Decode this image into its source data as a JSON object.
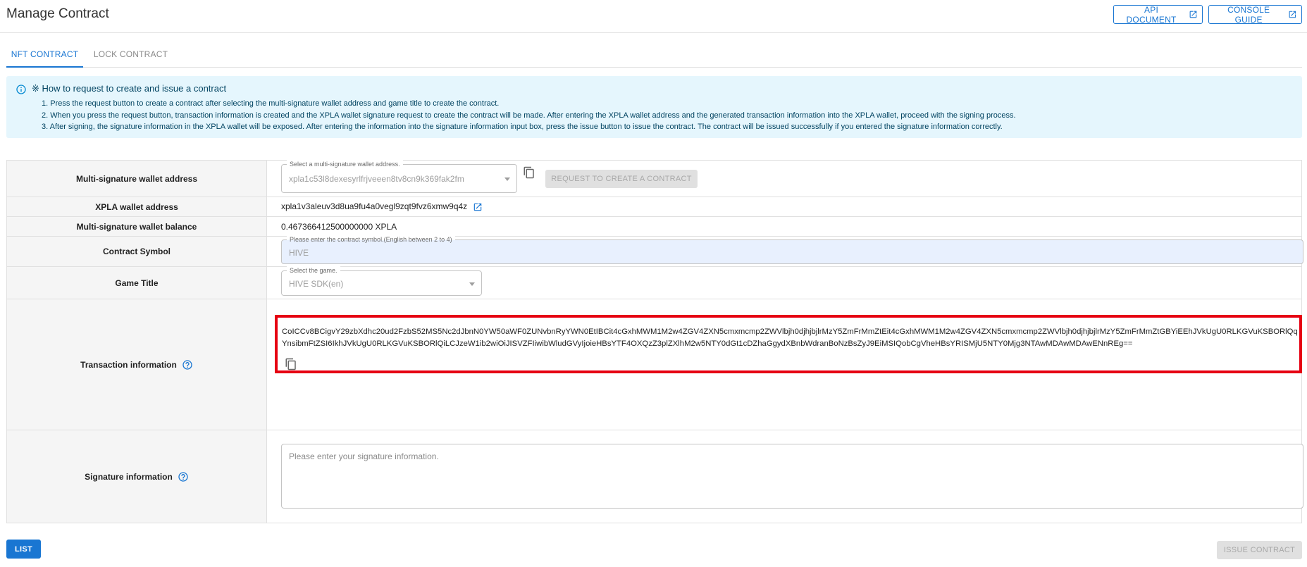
{
  "header": {
    "title": "Manage Contract",
    "api_document_label": "API DOCUMENT",
    "console_guide_label": "CONSOLE GUIDE"
  },
  "tabs": [
    {
      "label": "NFT CONTRACT",
      "active": true
    },
    {
      "label": "LOCK CONTRACT",
      "active": false
    }
  ],
  "info": {
    "title": "※ How to request to create and issue a contract",
    "steps": [
      "1. Press the request button to create a contract after selecting the multi-signature wallet address and game title to create the contract.",
      "2. When you press the request button, transaction information is created and the XPLA wallet signature request to create the contract will be made. After entering the XPLA wallet address and the generated transaction information into the XPLA wallet, proceed with the signing process.",
      "3. After signing, the signature information in the XPLA wallet will be exposed. After entering the information into the signature information input box, press the issue button to issue the contract. The contract will be issued successfully if you entered the signature information correctly."
    ]
  },
  "form": {
    "multisig_address": {
      "label": "Multi-signature wallet address",
      "select_legend": "Select a multi-signature wallet address.",
      "selected_value": "xpla1c53l8dexesyrlfrjveeen8tv8cn9k369fak2fm",
      "request_button_label": "REQUEST TO CREATE A CONTRACT"
    },
    "xpla_address": {
      "label": "XPLA wallet address",
      "value": "xpla1v3aleuv3d8ua9fu4a0vegl9zqt9fvz6xmw9q4z"
    },
    "multisig_balance": {
      "label": "Multi-signature wallet balance",
      "value": "0.467366412500000000 XPLA"
    },
    "contract_symbol": {
      "label": "Contract Symbol",
      "legend": "Please enter the contract symbol.(English between 2 to 4)",
      "value": "HIVE"
    },
    "game_title": {
      "label": "Game Title",
      "legend": "Select the game.",
      "value": "HIVE SDK(en)"
    },
    "transaction_info": {
      "label": "Transaction information",
      "value": "CoICCv8BCigvY29zbXdhc20ud2FzbS52MS5Nc2dJbnN0YW50aWF0ZUNvbnRyYWN0EtIBCit4cGxhMWM1M2w4ZGV4ZXN5cmxmcmp2ZWVlbjh0djhjbjlrMzY5ZmFrMmZtEit4cGxhMWM1M2w4ZGV4ZXN5cmxmcmp2ZWVlbjh0djhjbjlrMzY5ZmFrMmZtGBYiEEhJVkUgU0RLKGVuKSBORlQqYnsibmFtZSI6IkhJVkUgU0RLKGVuKSBORlQiLCJzeW1ib2wiOiJISVZFIiwibWludGVyIjoieHBsYTF4OXQzZ3plZXlhM2w5NTY0dGt1cDZhaGgydXBnbWdranBoNzBsZyJ9EiMSIQobCgVheHBsYRISMjU5NTY0Mjg3NTAwMDAwMDAwENnREg=="
    },
    "signature_info": {
      "label": "Signature information",
      "placeholder": "Please enter your signature information.",
      "value": ""
    }
  },
  "footer": {
    "list_label": "LIST",
    "issue_label": "ISSUE CONTRACT"
  },
  "colors": {
    "primary": "#1976d2",
    "info_bg": "#e5f6fd",
    "highlight_border": "#e60012"
  }
}
